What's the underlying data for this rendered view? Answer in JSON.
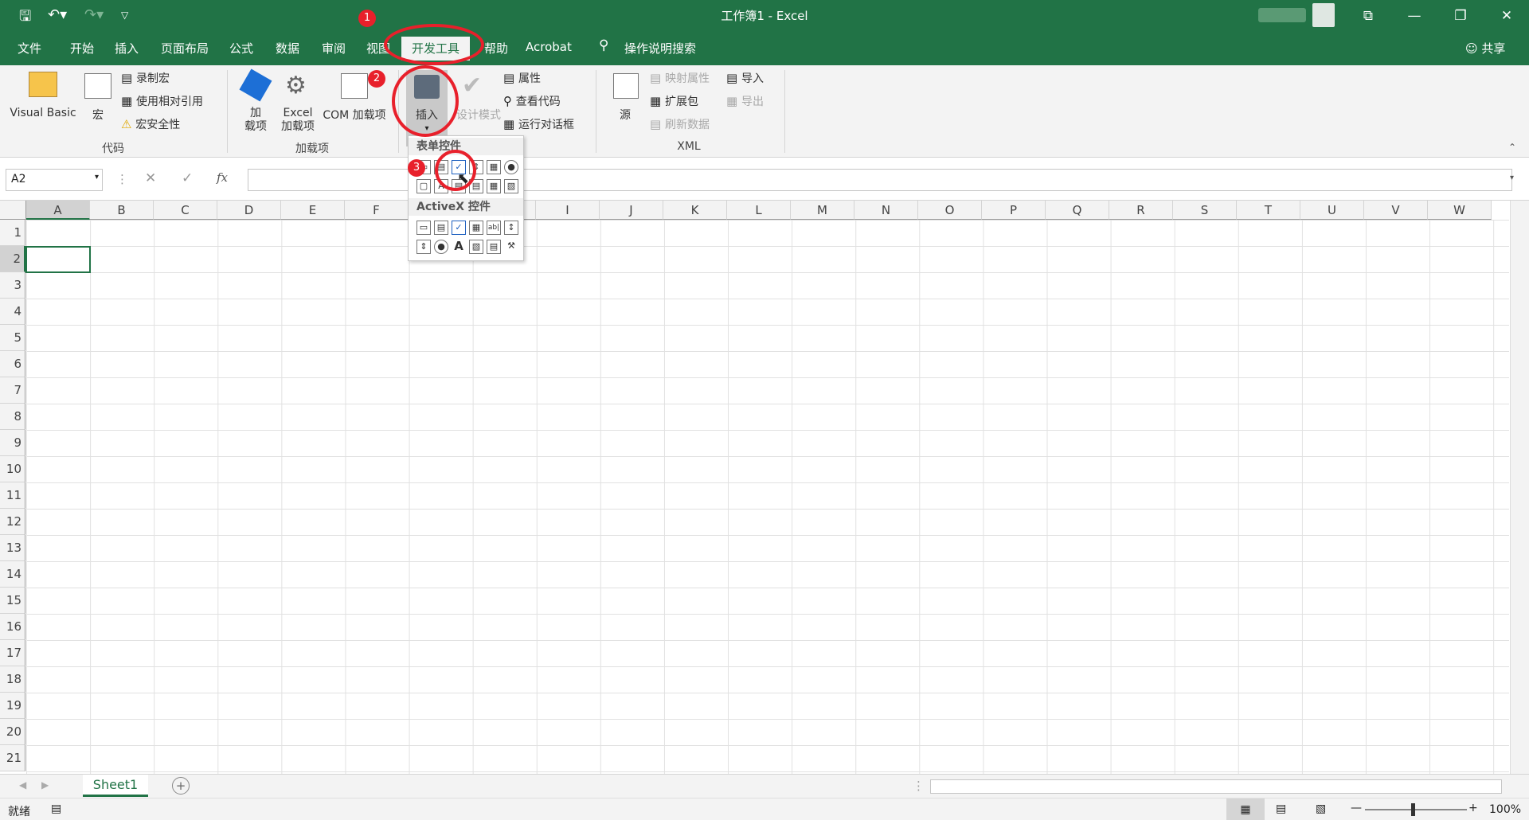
{
  "title": "工作簿1  -  Excel",
  "quick_access": {
    "save_icon": "save-icon",
    "undo_icon": "undo-icon",
    "redo_icon": "redo-icon",
    "customize_icon": "customize-icon"
  },
  "window_buttons": {
    "ribbon_display": "⧉",
    "minimize": "—",
    "restore": "❐",
    "close": "✕"
  },
  "tabs": [
    "文件",
    "开始",
    "插入",
    "页面布局",
    "公式",
    "数据",
    "审阅",
    "视图",
    "开发工具",
    "帮助",
    "Acrobat"
  ],
  "tell_me": "操作说明搜索",
  "share": "共享",
  "ribbon": {
    "code": {
      "visual_basic": "Visual Basic",
      "macros": "宏",
      "record_macro": "录制宏",
      "relative_ref": "使用相对引用",
      "macro_security": "宏安全性",
      "group_label": "代码"
    },
    "addins": {
      "addins": "加\n载项",
      "excel_addins": "Excel\n加载项",
      "com_addins": "COM 加载项",
      "group_label": "加载项"
    },
    "controls": {
      "insert": "插入",
      "design_mode": "设计模式",
      "properties": "属性",
      "view_code": "查看代码",
      "run_dialog": "运行对话框"
    },
    "xml": {
      "source": "源",
      "map_properties": "映射属性",
      "expansion_packs": "扩展包",
      "refresh_data": "刷新数据",
      "import": "导入",
      "export": "导出",
      "group_label": "XML"
    }
  },
  "dropdown": {
    "form_controls": "表单控件",
    "activex_controls": "ActiveX 控件"
  },
  "namebox": "A2",
  "fx": "fx",
  "columns": [
    "A",
    "B",
    "C",
    "D",
    "E",
    "F",
    "G",
    "H",
    "I",
    "J",
    "K",
    "L",
    "M",
    "N",
    "O",
    "P",
    "Q",
    "R",
    "S",
    "T",
    "U",
    "V",
    "W"
  ],
  "rows": [
    "1",
    "2",
    "3",
    "4",
    "5",
    "6",
    "7",
    "8",
    "9",
    "10",
    "11",
    "12",
    "13",
    "14",
    "15",
    "16",
    "17",
    "18",
    "19",
    "20",
    "21"
  ],
  "sheet_tab": "Sheet1",
  "status": {
    "ready": "就绪",
    "zoom": "100%"
  },
  "badges": [
    "1",
    "2",
    "3"
  ],
  "accent": "#217346",
  "highlight": "#e8202b"
}
